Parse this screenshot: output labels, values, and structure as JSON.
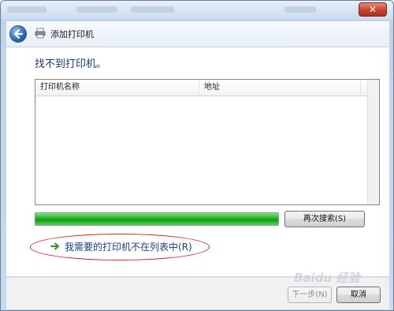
{
  "window": {
    "title": "添加打印机",
    "close_label": "✕"
  },
  "main": {
    "heading": "找不到打印机。",
    "list": {
      "columns": [
        "打印机名称",
        "地址"
      ],
      "rows": []
    },
    "progress": {
      "value": 1.0,
      "color": "#1fae1f"
    },
    "search_again_label": "再次搜索(S)",
    "not_listed_link": "我需要的打印机不在列表中(R)"
  },
  "footer": {
    "next_label": "下一步(N)",
    "cancel_label": "取消"
  },
  "watermark": "Baidu 经验",
  "icons": {
    "back": "back-arrow-icon",
    "printer": "printer-icon",
    "link_arrow": "green-arrow-icon"
  },
  "colors": {
    "heading": "#1b3a74",
    "link": "#1d3e86",
    "annotation": "#c8232c"
  }
}
